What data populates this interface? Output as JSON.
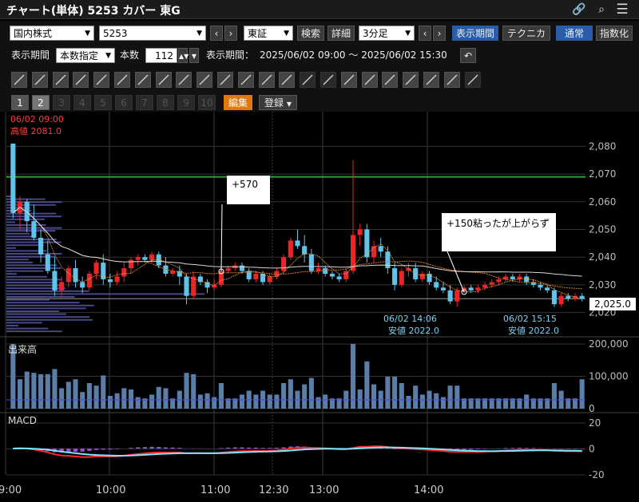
{
  "window": {
    "title": "チャート(単体) 5253 カバー 東G",
    "icons": [
      "link-icon",
      "search-icon",
      "menu-icon"
    ]
  },
  "toolbar1": {
    "market": "国内株式",
    "code": "5253",
    "exchange": "東証",
    "search_label": "検索",
    "detail_label": "詳細",
    "interval": "3分足",
    "period_label": "表示期間",
    "technical_label": "テクニカル",
    "normal_label": "通常",
    "index_label": "指数化"
  },
  "toolbar2": {
    "period_type_label": "表示期間",
    "period_type_value": "本数指定",
    "count_label": "本数",
    "count_value": "112",
    "range_label": "表示期間：",
    "range_value": "2025/06/02 09:00 ～ 2025/06/02 15:30"
  },
  "toolbar4": {
    "pages": [
      "1",
      "2",
      "3",
      "4",
      "5",
      "6",
      "7",
      "8",
      "9",
      "10"
    ],
    "edit_label": "編集",
    "register_label": "登録"
  },
  "chart": {
    "header_time": "06/02 09:00",
    "header_high": "高値 2081.0",
    "current_price": "2,025.0",
    "annotation1": "+570",
    "annotation2": "+150粘ったが上がらず",
    "low1_time": "06/02 14:06",
    "low1_value": "安値 2022.0",
    "low2_time": "06/02 15:15",
    "low2_value": "安値 2022.0",
    "volume_label": "出来高",
    "macd_label": "MACD"
  },
  "chart_data": {
    "type": "candlestick",
    "price_axis": {
      "ticks": [
        "2,080",
        "2,070",
        "2,060",
        "2,050",
        "2,040",
        "2,030",
        "2,020"
      ],
      "range": [
        2017,
        2083
      ]
    },
    "volume_axis": {
      "ticks": [
        "200,000",
        "100,000",
        "0"
      ]
    },
    "macd_axis": {
      "ticks": [
        "20",
        "0",
        "-20"
      ]
    },
    "x_ticks": [
      "9:00",
      "10:00",
      "11:00",
      "12:30",
      "13:00",
      "14:00"
    ],
    "resistance_line": 2069,
    "colors": {
      "up": "#e8262a",
      "down": "#5fc3ea",
      "resistance": "#2fa02f",
      "ma_short": "#e07a20",
      "ma_long": "#d8d8d8",
      "volume": "#5b7ea8",
      "macd": "#ff2a2a",
      "signal": "#7fe6ff",
      "histogram": "#a04ad8"
    },
    "candles": [
      [
        2081,
        2081,
        2054,
        2056
      ],
      [
        2056,
        2062,
        2050,
        2060
      ],
      [
        2060,
        2061,
        2049,
        2053
      ],
      [
        2053,
        2059,
        2046,
        2047
      ],
      [
        2047,
        2050,
        2038,
        2041
      ],
      [
        2041,
        2046,
        2034,
        2035
      ],
      [
        2035,
        2040,
        2026,
        2028
      ],
      [
        2028,
        2033,
        2026,
        2031
      ],
      [
        2031,
        2037,
        2029,
        2036
      ],
      [
        2036,
        2039,
        2029,
        2031
      ],
      [
        2031,
        2033,
        2027,
        2029
      ],
      [
        2029,
        2035,
        2028,
        2034
      ],
      [
        2034,
        2039,
        2032,
        2038
      ],
      [
        2038,
        2041,
        2030,
        2032
      ],
      [
        2032,
        2034,
        2029,
        2031
      ],
      [
        2031,
        2035,
        2030,
        2033
      ],
      [
        2033,
        2038,
        2031,
        2036
      ],
      [
        2036,
        2040,
        2034,
        2039
      ],
      [
        2039,
        2041,
        2037,
        2040
      ],
      [
        2040,
        2041,
        2038,
        2039
      ],
      [
        2039,
        2042,
        2038,
        2041
      ],
      [
        2041,
        2042,
        2036,
        2037
      ],
      [
        2037,
        2040,
        2033,
        2034
      ],
      [
        2034,
        2036,
        2033,
        2035
      ],
      [
        2035,
        2037,
        2030,
        2033
      ],
      [
        2033,
        2034,
        2023,
        2026
      ],
      [
        2026,
        2035,
        2025,
        2033
      ],
      [
        2033,
        2034,
        2030,
        2031
      ],
      [
        2031,
        2032,
        2027,
        2029
      ],
      [
        2029,
        2032,
        2028,
        2030
      ],
      [
        2030,
        2036,
        2029,
        2035
      ],
      [
        2035,
        2037,
        2034,
        2036
      ],
      [
        2036,
        2038,
        2035,
        2037
      ],
      [
        2037,
        2038,
        2034,
        2035
      ],
      [
        2035,
        2036,
        2031,
        2032
      ],
      [
        2032,
        2035,
        2031,
        2034
      ],
      [
        2034,
        2035,
        2030,
        2031
      ],
      [
        2031,
        2034,
        2030,
        2033
      ],
      [
        2033,
        2036,
        2032,
        2035
      ],
      [
        2035,
        2041,
        2034,
        2040
      ],
      [
        2040,
        2047,
        2039,
        2046
      ],
      [
        2046,
        2050,
        2043,
        2044
      ],
      [
        2044,
        2048,
        2038,
        2041
      ],
      [
        2041,
        2043,
        2034,
        2035
      ],
      [
        2035,
        2038,
        2034,
        2036
      ],
      [
        2036,
        2037,
        2033,
        2034
      ],
      [
        2034,
        2035,
        2032,
        2033
      ],
      [
        2033,
        2034,
        2031,
        2032
      ],
      [
        2032,
        2036,
        2031,
        2035
      ],
      [
        2035,
        2075,
        2034,
        2048
      ],
      [
        2048,
        2052,
        2044,
        2050
      ],
      [
        2050,
        2052,
        2038,
        2040
      ],
      [
        2040,
        2046,
        2038,
        2044
      ],
      [
        2044,
        2047,
        2040,
        2042
      ],
      [
        2042,
        2044,
        2034,
        2036
      ],
      [
        2036,
        2038,
        2028,
        2030
      ],
      [
        2030,
        2036,
        2029,
        2035
      ],
      [
        2035,
        2038,
        2033,
        2036
      ],
      [
        2036,
        2038,
        2031,
        2032
      ],
      [
        2032,
        2035,
        2031,
        2034
      ],
      [
        2034,
        2035,
        2030,
        2031
      ],
      [
        2031,
        2033,
        2028,
        2029
      ],
      [
        2029,
        2031,
        2027,
        2028
      ],
      [
        2028,
        2030,
        2023,
        2024
      ],
      [
        2024,
        2029,
        2022,
        2028
      ],
      [
        2028,
        2030,
        2027,
        2029
      ],
      [
        2029,
        2030,
        2027,
        2028
      ],
      [
        2028,
        2030,
        2027,
        2029
      ],
      [
        2029,
        2031,
        2028,
        2030
      ],
      [
        2030,
        2032,
        2029,
        2031
      ],
      [
        2031,
        2033,
        2030,
        2032
      ],
      [
        2032,
        2034,
        2031,
        2033
      ],
      [
        2033,
        2034,
        2031,
        2032
      ],
      [
        2032,
        2034,
        2031,
        2033
      ],
      [
        2033,
        2034,
        2030,
        2031
      ],
      [
        2031,
        2032,
        2029,
        2030
      ],
      [
        2030,
        2031,
        2028,
        2029
      ],
      [
        2029,
        2030,
        2027,
        2028
      ],
      [
        2028,
        2029,
        2022,
        2023
      ],
      [
        2023,
        2027,
        2022,
        2026
      ],
      [
        2026,
        2027,
        2024,
        2025
      ],
      [
        2025,
        2027,
        2024,
        2026
      ],
      [
        2026,
        2027,
        2024,
        2025
      ]
    ]
  }
}
